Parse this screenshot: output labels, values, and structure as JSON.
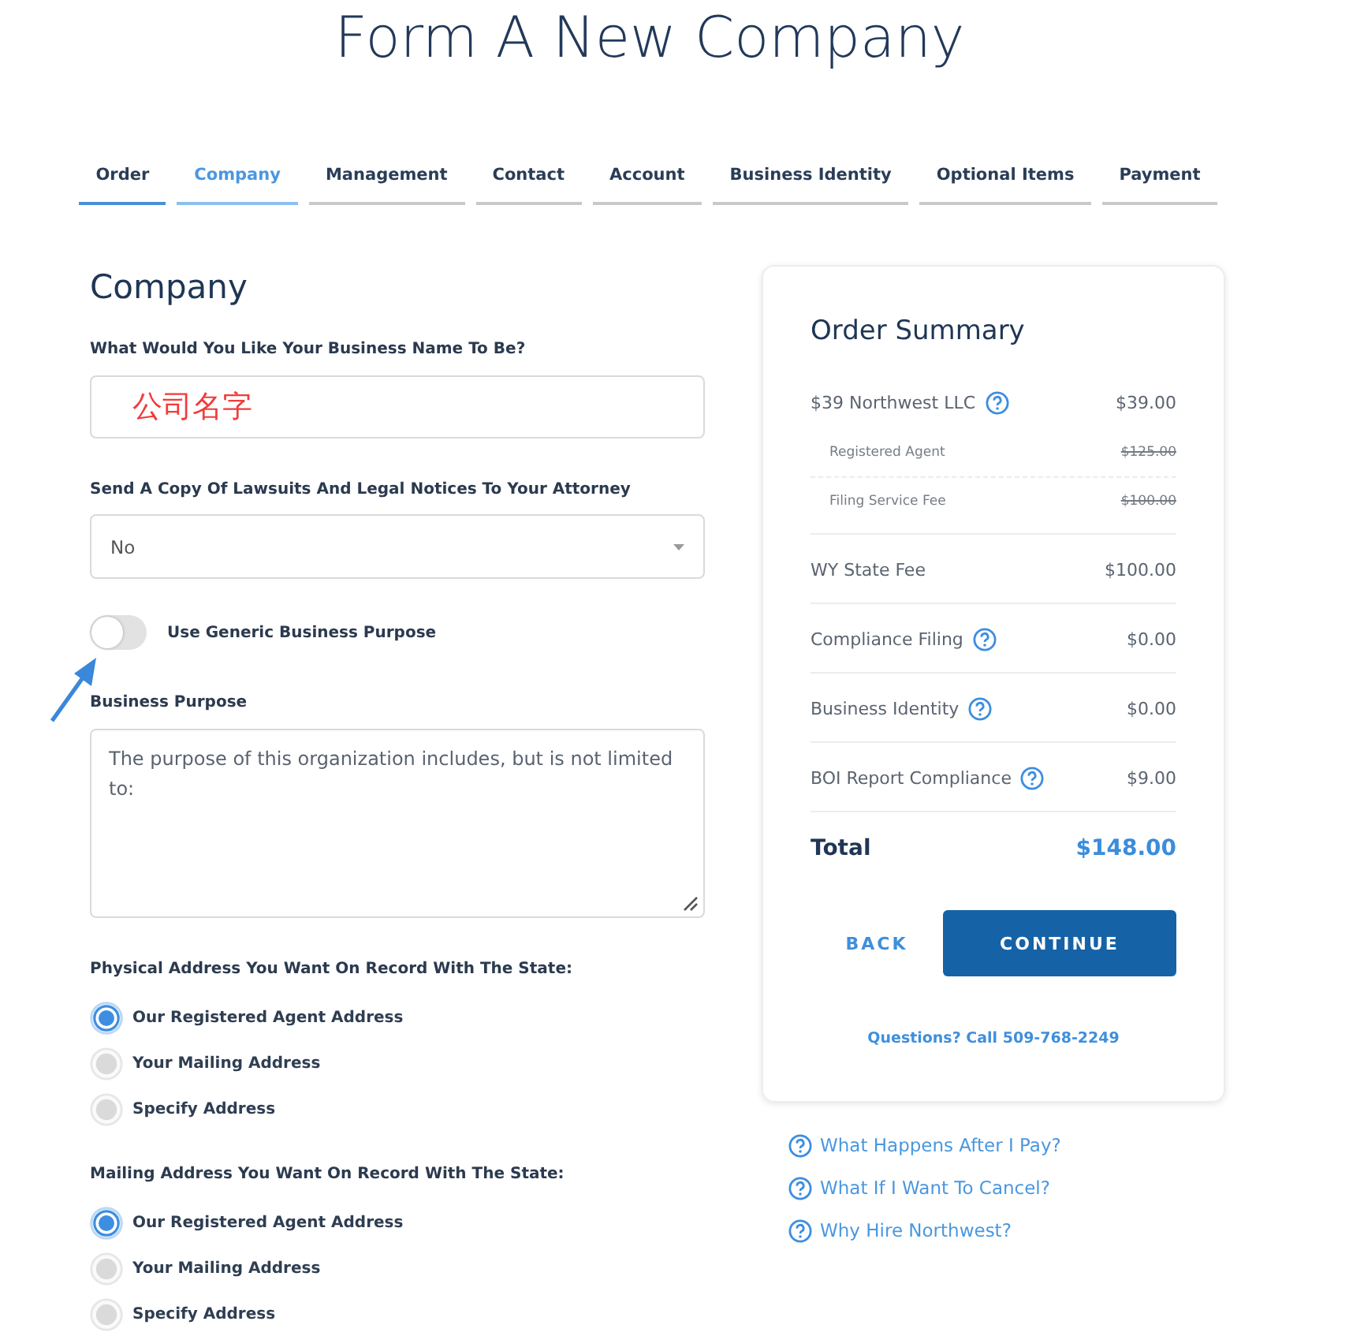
{
  "page_title": "Form A New Company",
  "steps": [
    {
      "label": "Order",
      "selected": false,
      "completed": true
    },
    {
      "label": "Company",
      "selected": true,
      "completed": false
    },
    {
      "label": "Management",
      "selected": false,
      "completed": false
    },
    {
      "label": "Contact",
      "selected": false,
      "completed": false
    },
    {
      "label": "Account",
      "selected": false,
      "completed": false
    },
    {
      "label": "Business Identity",
      "selected": false,
      "completed": false
    },
    {
      "label": "Optional Items",
      "selected": false,
      "completed": false
    },
    {
      "label": "Payment",
      "selected": false,
      "completed": false
    }
  ],
  "form": {
    "heading": "Company",
    "business_name": {
      "label": "What Would You Like Your Business Name To Be?",
      "value": "公司名字"
    },
    "attorney_copy": {
      "label": "Send A Copy Of Lawsuits And Legal Notices To Your Attorney",
      "value": "No"
    },
    "generic_purpose": {
      "label": "Use Generic Business Purpose",
      "on": false
    },
    "business_purpose": {
      "label": "Business Purpose",
      "value": "The purpose of this organization includes, but is not limited to:"
    },
    "address_groups": [
      {
        "label": "Physical Address You Want On Record With The State:",
        "options": [
          {
            "label": "Our Registered Agent Address",
            "selected": true
          },
          {
            "label": "Your Mailing Address",
            "selected": false
          },
          {
            "label": "Specify Address",
            "selected": false
          }
        ]
      },
      {
        "label": "Mailing Address You Want On Record With The State:",
        "options": [
          {
            "label": "Our Registered Agent Address",
            "selected": true
          },
          {
            "label": "Your Mailing Address",
            "selected": false
          },
          {
            "label": "Specify Address",
            "selected": false
          }
        ]
      }
    ]
  },
  "order_summary": {
    "title": "Order Summary",
    "groups": [
      {
        "label": "$39 Northwest LLC",
        "price": "$39.00",
        "help": true,
        "subitems": [
          {
            "label": "Registered Agent",
            "price": "$125.00",
            "struck": true
          },
          {
            "label": "Filing Service Fee",
            "price": "$100.00",
            "struck": true
          }
        ]
      },
      {
        "label": "WY State Fee",
        "price": "$100.00",
        "help": false
      },
      {
        "label": "Compliance Filing",
        "price": "$0.00",
        "help": true
      },
      {
        "label": "Business Identity",
        "price": "$0.00",
        "help": true
      },
      {
        "label": "BOI Report Compliance",
        "price": "$9.00",
        "help": true
      }
    ],
    "total": {
      "label": "Total",
      "amount": "$148.00"
    },
    "back": "BACK",
    "continue": "CONTINUE",
    "phone_note": "Questions? Call 509-768-2249"
  },
  "help_links": [
    "What Happens After I Pay?",
    "What If I Want To Cancel?",
    "Why Hire Northwest?"
  ]
}
